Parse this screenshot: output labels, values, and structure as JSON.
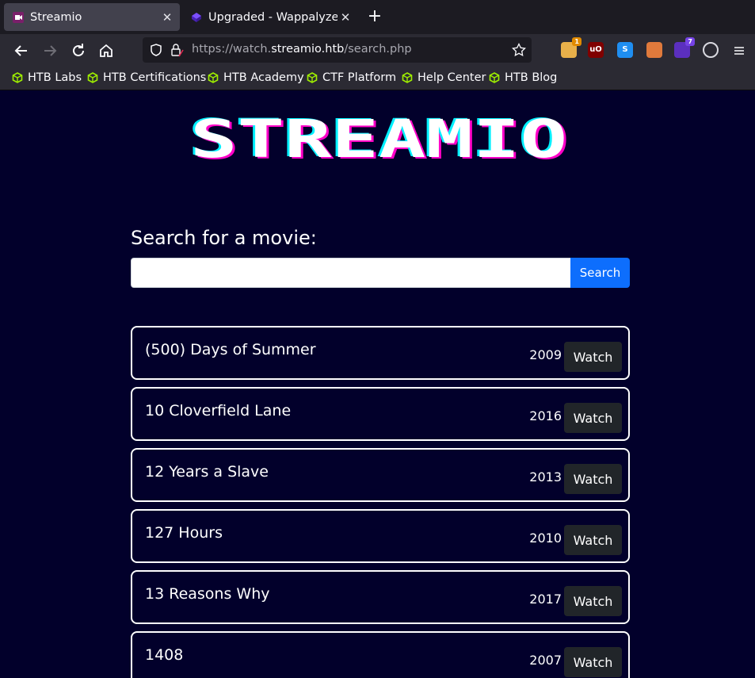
{
  "browser": {
    "tabs": [
      {
        "title": "Streamio",
        "active": true
      },
      {
        "title": "Upgraded - Wappalyzer",
        "active": false
      }
    ],
    "url": {
      "prefix": "https://watch.",
      "host": "streamio.htb",
      "path": "/search.php"
    },
    "extensions": [
      {
        "name": "ghostery-extension-icon",
        "badge": "1",
        "color": "#e8b04a"
      },
      {
        "name": "ublock-extension-icon",
        "badge": "",
        "color": "#800000"
      },
      {
        "name": "s-extension-icon",
        "badge": "",
        "color": "#1f8ef1"
      },
      {
        "name": "cookie-extension-icon",
        "badge": "",
        "color": "#e07a3c"
      },
      {
        "name": "wappalyzer-extension-icon",
        "badge": "7",
        "color": "#5b2fbf"
      },
      {
        "name": "cookie-editor-extension-icon",
        "badge": "",
        "color": "#d9d9e0"
      }
    ],
    "bookmarks": [
      "HTB Labs",
      "HTB Certifications",
      "HTB Academy",
      "CTF Platform",
      "Help Center",
      "HTB Blog"
    ]
  },
  "page": {
    "logo_text": "STREAMIO",
    "search_label": "Search for a movie:",
    "search_value": "",
    "search_button": "Search",
    "watch_label": "Watch",
    "movies": [
      {
        "title": "(500) Days of Summer",
        "year": "2009"
      },
      {
        "title": "10 Cloverfield Lane",
        "year": "2016"
      },
      {
        "title": "12 Years a Slave",
        "year": "2013"
      },
      {
        "title": "127 Hours",
        "year": "2010"
      },
      {
        "title": "13 Reasons Why",
        "year": "2017"
      },
      {
        "title": "1408",
        "year": "2007"
      }
    ]
  },
  "colors": {
    "page_bg": "#02002b",
    "accent_blue": "#0d6efd",
    "logo_cyan": "#00f0ff",
    "logo_magenta": "#ff00c8",
    "bookmark_green": "#9fef00"
  }
}
